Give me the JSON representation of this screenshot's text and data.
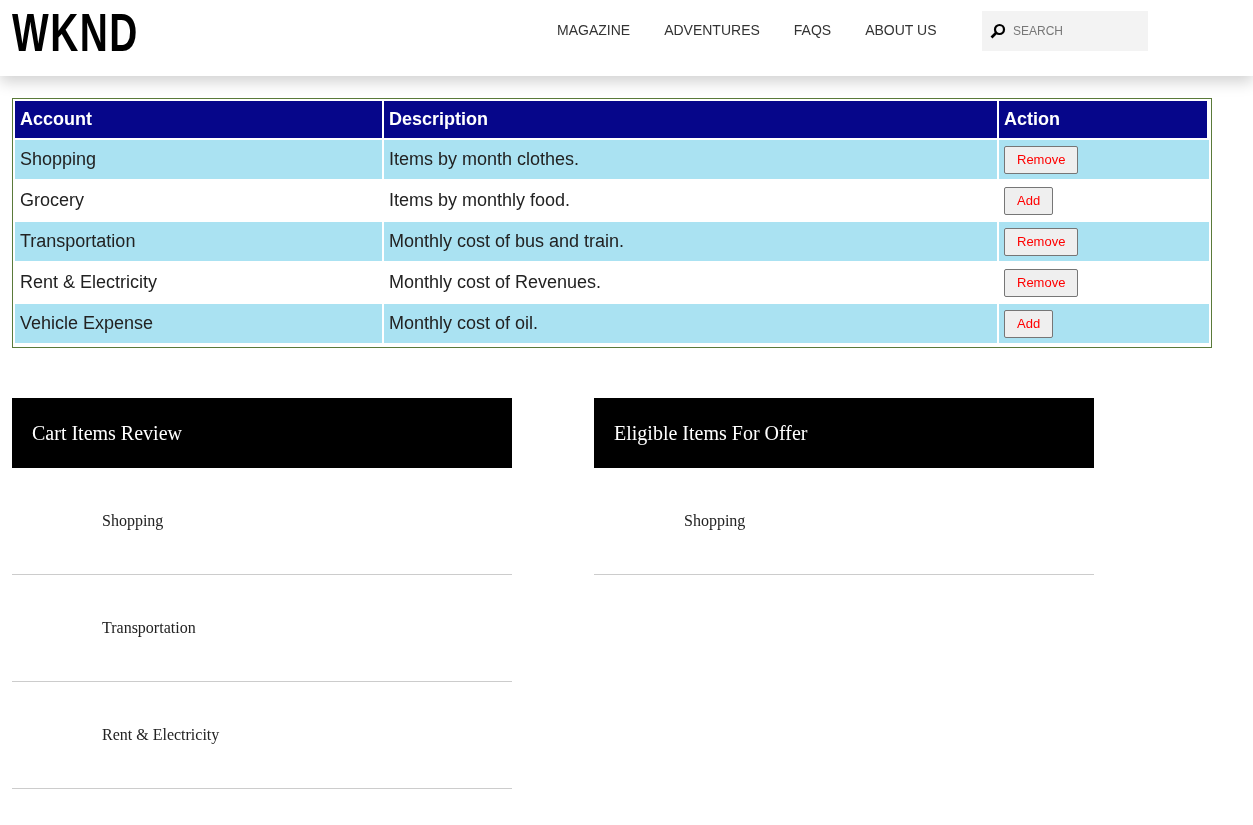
{
  "header": {
    "logo": "WKND",
    "nav": [
      {
        "label": "MAGAZINE"
      },
      {
        "label": "ADVENTURES"
      },
      {
        "label": "FAQS"
      },
      {
        "label": "ABOUT US"
      }
    ],
    "search": {
      "placeholder": "SEARCH"
    }
  },
  "table": {
    "columns": [
      "Account",
      "Description",
      "Action"
    ],
    "rows": [
      {
        "account": "Shopping",
        "description": "Items by month clothes.",
        "action": "Remove"
      },
      {
        "account": "Grocery",
        "description": "Items by monthly food.",
        "action": "Add"
      },
      {
        "account": "Transportation",
        "description": "Monthly cost of bus and train.",
        "action": "Remove"
      },
      {
        "account": "Rent & Electricity",
        "description": "Monthly cost of Revenues.",
        "action": "Remove"
      },
      {
        "account": "Vehicle Expense",
        "description": "Monthly cost of oil.",
        "action": "Add"
      }
    ]
  },
  "panels": [
    {
      "title": "Cart Items Review",
      "items": [
        "Shopping",
        "Transportation",
        "Rent & Electricity"
      ]
    },
    {
      "title": "Eligible Items For Offer",
      "items": [
        "Shopping"
      ]
    }
  ]
}
